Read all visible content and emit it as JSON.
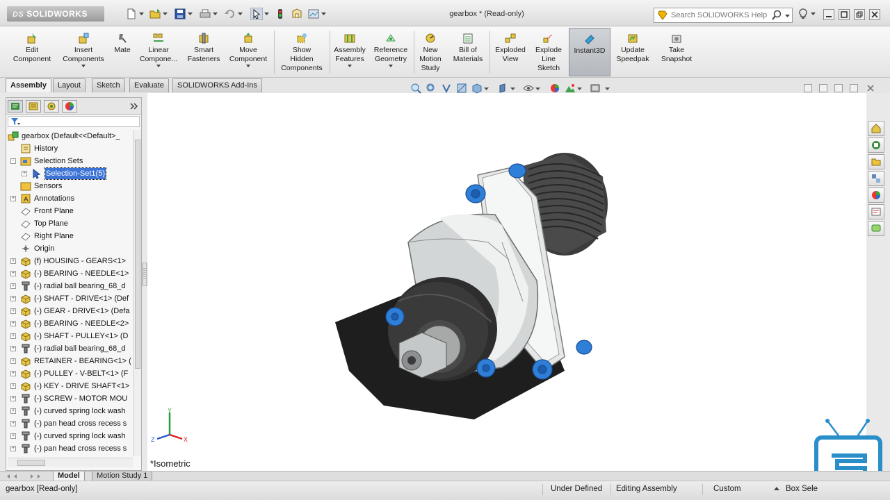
{
  "app": {
    "logo_text": "SOLIDWORKS",
    "logo_mark": "DS",
    "document_title": "gearbox * (Read-only)"
  },
  "help_search": {
    "placeholder": "Search SOLIDWORKS Help"
  },
  "command_manager": {
    "commands": [
      {
        "label": "Edit\nComponent",
        "icon": "edit-component-icon"
      },
      {
        "label": "Insert\nComponents",
        "icon": "insert-components-icon",
        "dropdown": true
      },
      {
        "label": "Mate",
        "icon": "mate-icon"
      },
      {
        "label": "Linear\nCompone...",
        "icon": "linear-pattern-icon",
        "dropdown": true
      },
      {
        "label": "Smart\nFasteners",
        "icon": "smart-fasteners-icon"
      },
      {
        "label": "Move\nComponent",
        "icon": "move-component-icon",
        "dropdown": true
      },
      {
        "label": "Show\nHidden\nComponents",
        "icon": "show-hidden-icon"
      },
      {
        "label": "Assembly\nFeatures",
        "icon": "assembly-features-icon",
        "dropdown": true
      },
      {
        "label": "Reference\nGeometry",
        "icon": "reference-geometry-icon",
        "dropdown": true
      },
      {
        "label": "New\nMotion\nStudy",
        "icon": "motion-study-icon"
      },
      {
        "label": "Bill of\nMaterials",
        "icon": "bill-of-materials-icon"
      },
      {
        "label": "Exploded\nView",
        "icon": "exploded-view-icon"
      },
      {
        "label": "Explode\nLine\nSketch",
        "icon": "explode-line-sketch-icon"
      },
      {
        "label": "Instant3D",
        "icon": "instant3d-icon",
        "active": true
      },
      {
        "label": "Update\nSpeedpak",
        "icon": "speedpak-icon"
      },
      {
        "label": "Take\nSnapshot",
        "icon": "snapshot-icon"
      }
    ]
  },
  "command_tabs": [
    "Assembly",
    "Layout",
    "Sketch",
    "Evaluate",
    "SOLIDWORKS Add-Ins"
  ],
  "command_tabs_active": "Assembly",
  "feature_tree": {
    "root": "gearbox  (Default<<Default>_",
    "items": [
      {
        "label": "History",
        "icon": "history-icon",
        "expander": ""
      },
      {
        "label": "Selection Sets",
        "icon": "selection-sets-icon",
        "expander": "-"
      },
      {
        "label": "Selection-Set1(5)",
        "icon": "selection-set-icon",
        "expander": "+",
        "indent": 1,
        "selected": true
      },
      {
        "label": "Sensors",
        "icon": "sensors-icon",
        "expander": ""
      },
      {
        "label": "Annotations",
        "icon": "annotations-icon",
        "expander": "+"
      },
      {
        "label": "Front Plane",
        "icon": "plane-icon",
        "expander": ""
      },
      {
        "label": "Top Plane",
        "icon": "plane-icon",
        "expander": ""
      },
      {
        "label": "Right Plane",
        "icon": "plane-icon",
        "expander": ""
      },
      {
        "label": "Origin",
        "icon": "origin-icon",
        "expander": ""
      },
      {
        "label": "(f) HOUSING - GEARS<1> ",
        "icon": "part-icon",
        "expander": "+"
      },
      {
        "label": "(-) BEARING - NEEDLE<1>",
        "icon": "part-icon",
        "expander": "+"
      },
      {
        "label": "(-) radial ball bearing_68_d",
        "icon": "toolbox-part-icon",
        "expander": "+"
      },
      {
        "label": "(-) SHAFT - DRIVE<1> (Def",
        "icon": "part-icon",
        "expander": "+"
      },
      {
        "label": "(-) GEAR - DRIVE<1> (Defa",
        "icon": "part-icon",
        "expander": "+"
      },
      {
        "label": "(-) BEARING - NEEDLE<2>",
        "icon": "part-icon",
        "expander": "+"
      },
      {
        "label": "(-) SHAFT - PULLEY<1> (D",
        "icon": "part-icon",
        "expander": "+"
      },
      {
        "label": "(-) radial ball bearing_68_d",
        "icon": "toolbox-part-icon",
        "expander": "+"
      },
      {
        "label": "RETAINER - BEARING<1> (",
        "icon": "part-icon",
        "expander": "+"
      },
      {
        "label": "(-) PULLEY - V-BELT<1> (F",
        "icon": "part-icon",
        "expander": "+"
      },
      {
        "label": "(-) KEY - DRIVE SHAFT<1>",
        "icon": "part-icon",
        "expander": "+"
      },
      {
        "label": "(-) SCREW - MOTOR MOU",
        "icon": "toolbox-part-icon",
        "expander": "+"
      },
      {
        "label": "(-) curved spring lock wash",
        "icon": "toolbox-part-icon",
        "expander": "+"
      },
      {
        "label": "(-) pan head cross recess s",
        "icon": "toolbox-part-icon",
        "expander": "+"
      },
      {
        "label": "(-) curved spring lock wash",
        "icon": "toolbox-part-icon",
        "expander": "+"
      },
      {
        "label": "(-) pan head cross recess s",
        "icon": "toolbox-part-icon",
        "expander": "+"
      }
    ]
  },
  "graphics": {
    "view_orientation": "*Isometric",
    "triad_axes": [
      "Y",
      "Z",
      "X"
    ]
  },
  "bottom_tabs": [
    "Model",
    "Motion Study 1"
  ],
  "status_bar": {
    "document": "gearbox [Read-only]",
    "constraint": "Under Defined",
    "mode": "Editing Assembly",
    "units": "Custom",
    "selection": "Box Sele"
  },
  "colors": {
    "accent_blue": "#3b73d6",
    "fastener_blue": "#2f7ed8",
    "housing_gray": "#d9dcdc",
    "dark_gray": "#3a3a3a"
  }
}
